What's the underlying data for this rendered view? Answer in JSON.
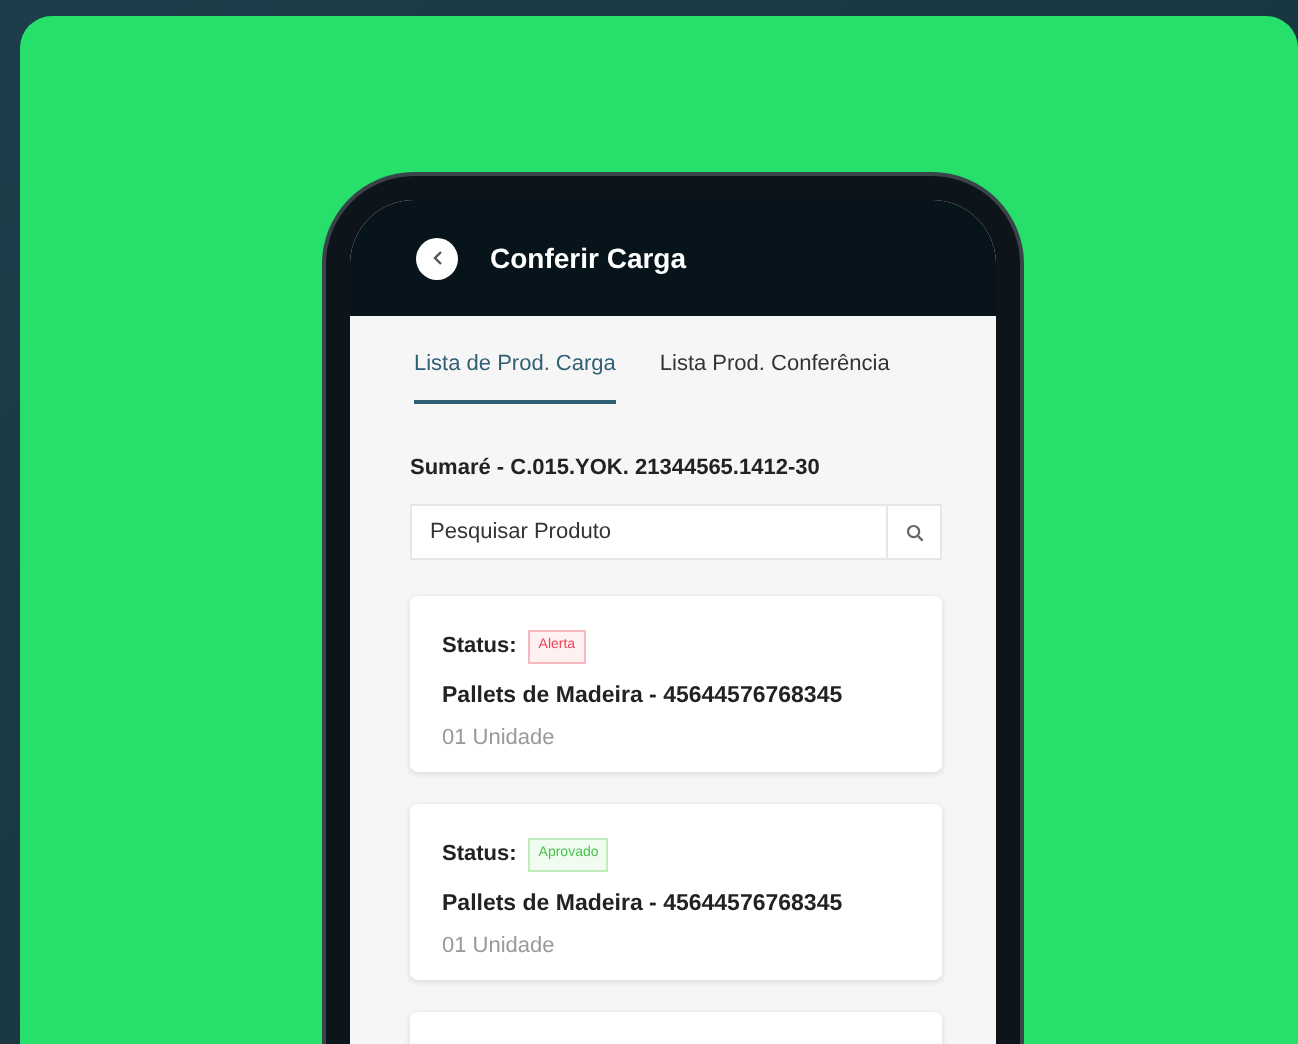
{
  "app_bar": {
    "title": "Conferir Carga"
  },
  "tabs": [
    {
      "label": "Lista de Prod. Carga",
      "selected": true
    },
    {
      "label": "Lista Prod. Conferência",
      "selected": false
    }
  ],
  "load_code": "Sumaré - C.015.YOK. 21344565.1412-30",
  "search": {
    "placeholder": "Pesquisar Produto"
  },
  "products": [
    {
      "status_label": "Status:",
      "status": {
        "kind": "alert",
        "text": "Alerta"
      },
      "name": "Pallets de Madeira - 45644576768345",
      "quantity": "01 Unidade"
    },
    {
      "status_label": "Status:",
      "status": {
        "kind": "approved",
        "text": "Aprovado"
      },
      "name": "Pallets de Madeira - 45644576768345",
      "quantity": "01 Unidade"
    }
  ]
}
